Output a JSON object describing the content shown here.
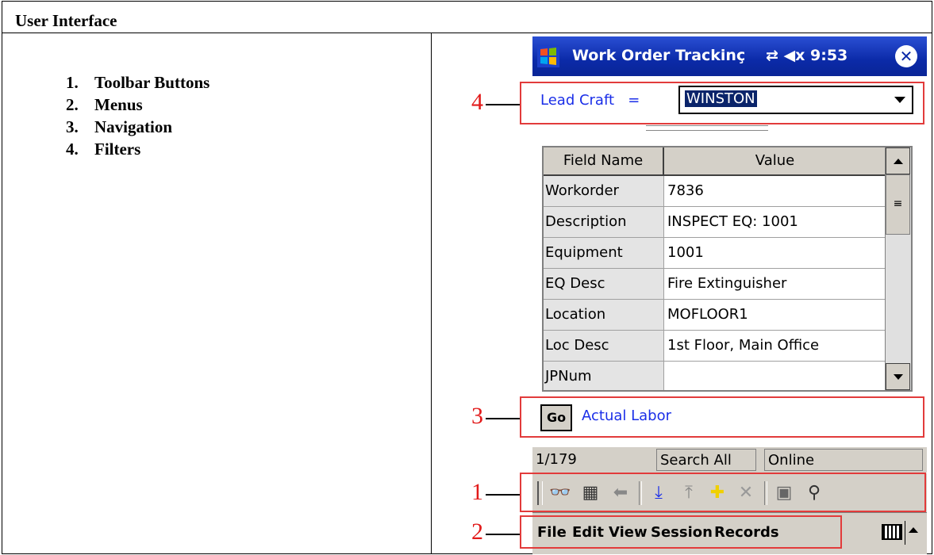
{
  "header": {
    "title": "User Interface"
  },
  "legend_items": [
    {
      "num": "1.",
      "label": "Toolbar Buttons"
    },
    {
      "num": "2.",
      "label": "Menus"
    },
    {
      "num": "3.",
      "label": "Navigation"
    },
    {
      "num": "4.",
      "label": "Filters"
    }
  ],
  "device": {
    "titlebar": {
      "title": "Work Order Trackinç",
      "status": "⇄ ◀x 9:53"
    },
    "filter": {
      "label": "Lead Craft",
      "op": "=",
      "value": "WINSTON"
    },
    "grid": {
      "headers": [
        "Field Name",
        "Value"
      ],
      "rows": [
        {
          "field": "Workorder",
          "value": "7836"
        },
        {
          "field": "Description",
          "value": "INSPECT EQ: 1001"
        },
        {
          "field": "Equipment",
          "value": "1001"
        },
        {
          "field": "EQ Desc",
          "value": "Fire Extinguisher"
        },
        {
          "field": "Location",
          "value": "MOFLOOR1"
        },
        {
          "field": "Loc Desc",
          "value": "1st Floor, Main Office"
        },
        {
          "field": "JPNum",
          "value": ""
        }
      ]
    },
    "navigation": {
      "go_label": "Go",
      "link_label": "Actual Labor"
    },
    "status": {
      "record": "1/179",
      "search": "Search All",
      "mode": "Online"
    },
    "menus": [
      "File",
      "Edit",
      "View",
      "Session",
      "Records"
    ]
  },
  "callouts": [
    "1",
    "2",
    "3",
    "4"
  ],
  "colors": {
    "callout": "#e23b3b",
    "titlebar": "#0b2aa8",
    "link": "#1a2ee8",
    "selection": "#0a246a"
  }
}
